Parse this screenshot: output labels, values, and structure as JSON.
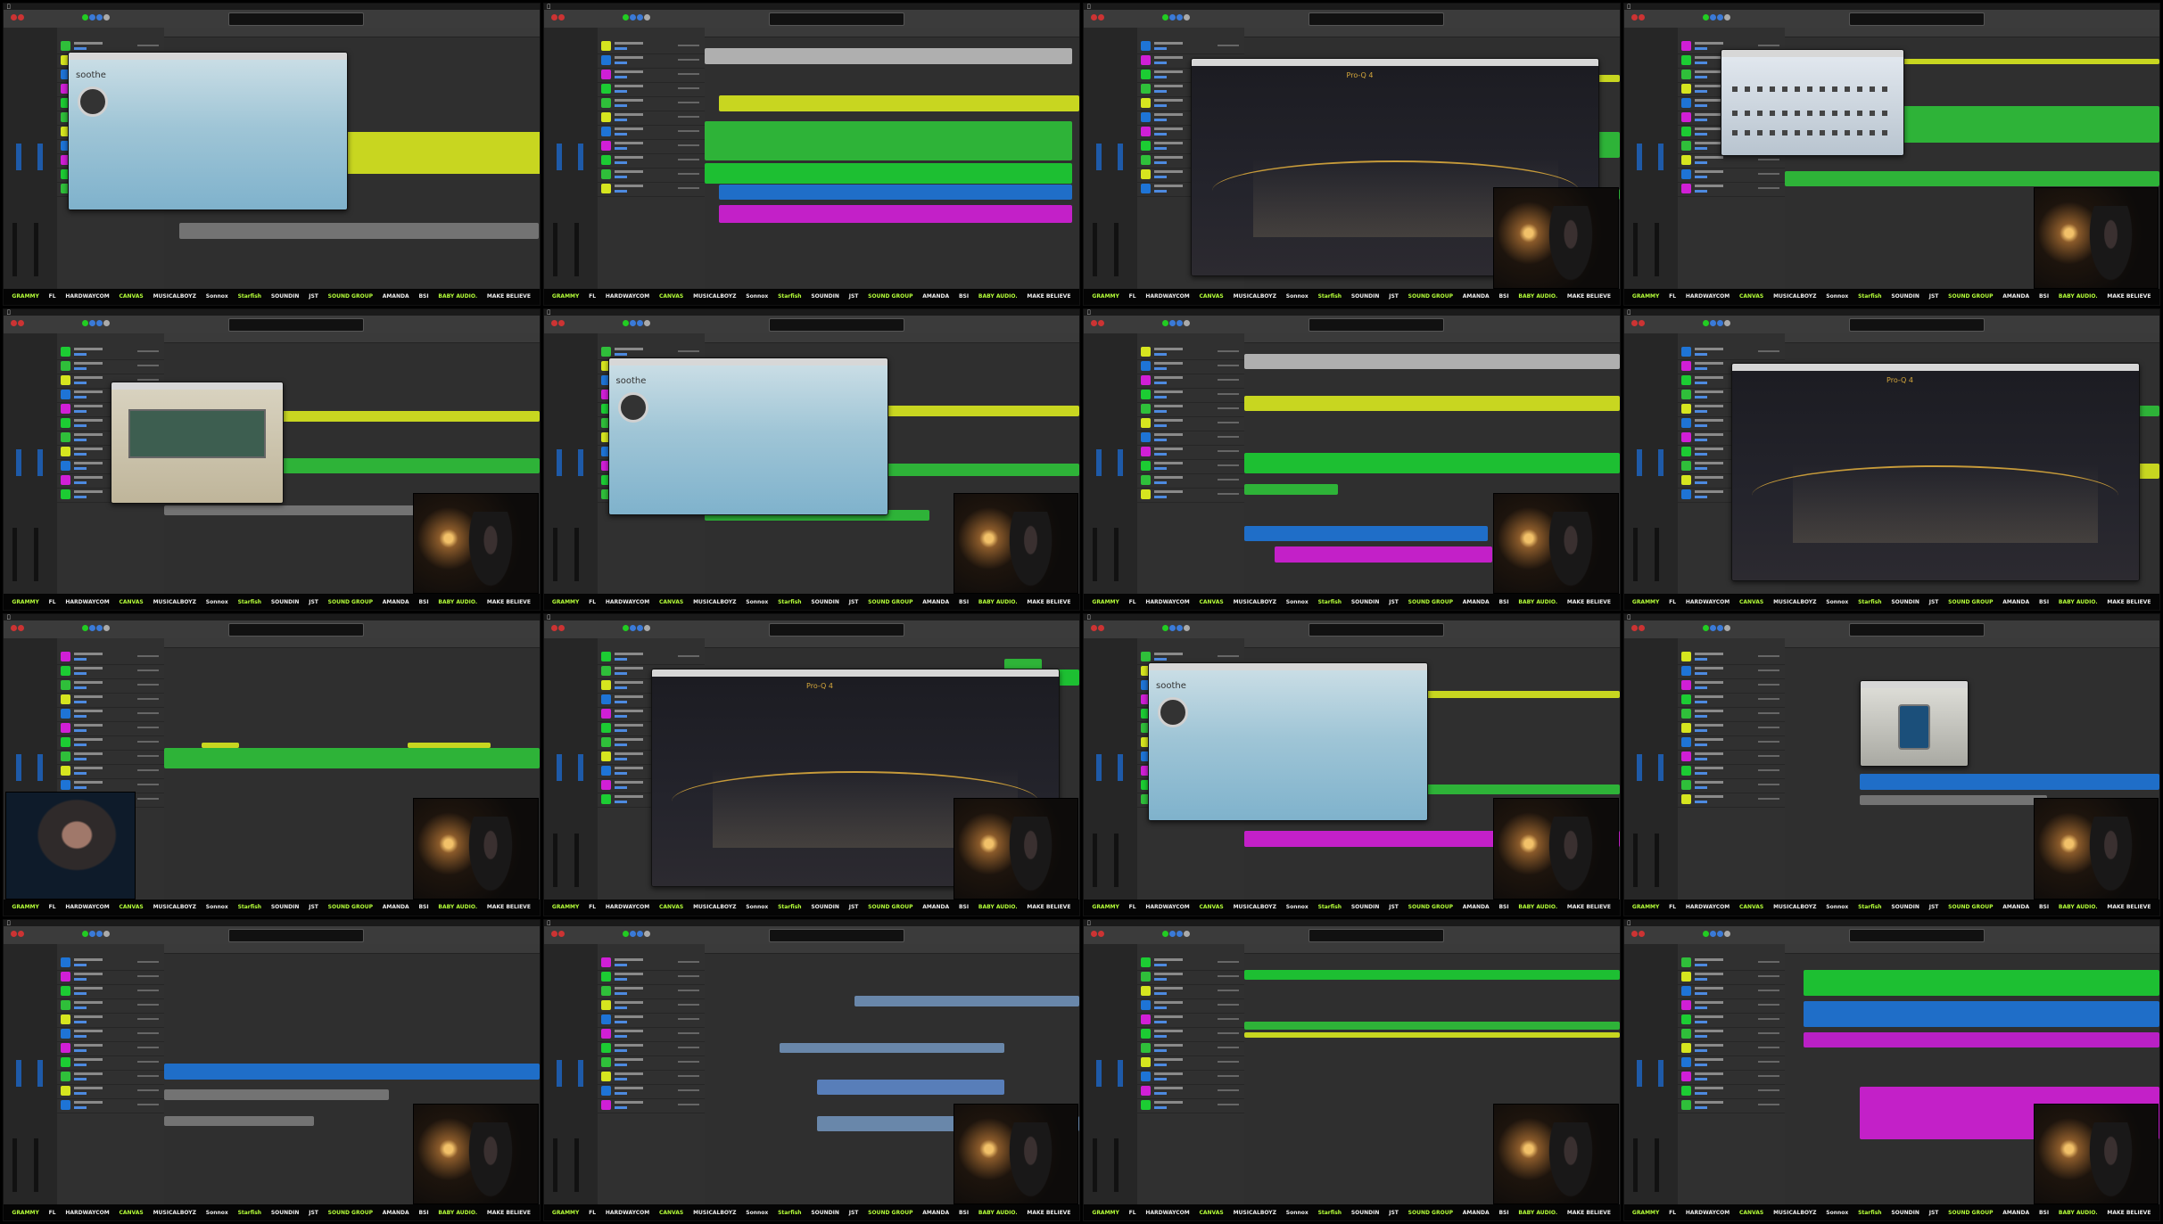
{
  "sponsors": [
    "GRAMMY",
    "FL",
    "HARDWAYCOM",
    "CANVAS",
    "MUSICALBOYZ",
    "Sonnox",
    "Starfish",
    "SOUNDIN",
    "JST",
    "SOUND GROUP",
    "AMANDA",
    "BSI",
    "BABY AUDIO.",
    "MAKE BELIEVE"
  ],
  "plugins": {
    "soothe": "soothe",
    "proq": "Pro-Q 4",
    "pultec": "PULTEC",
    "la2a": "TCA 2A",
    "eqp": "EQP"
  },
  "tiles": [
    {
      "plugin": "soothe",
      "cam": false,
      "regions": [
        [
          "#d6e51f",
          20,
          40,
          100,
          16
        ],
        [
          "#7a7a7a",
          4,
          75,
          96,
          6
        ]
      ]
    },
    {
      "plugin": null,
      "cam": false,
      "regions": [
        [
          "#bbbbbb",
          0,
          8,
          98,
          6
        ],
        [
          "#d6e51f",
          4,
          26,
          96,
          6
        ],
        [
          "#2fbf3a",
          0,
          36,
          98,
          15
        ],
        [
          "#1ccc33",
          0,
          52,
          98,
          8
        ],
        [
          "#1e74d6",
          4,
          60,
          94,
          6
        ],
        [
          "#d01fd6",
          4,
          68,
          94,
          7
        ]
      ]
    },
    {
      "plugin": "proq",
      "cam": true,
      "regions": [
        [
          "#2fbf3a",
          0,
          40,
          100,
          10
        ],
        [
          "#2fbf3a",
          0,
          62,
          100,
          4
        ],
        [
          "#d6e51f",
          0,
          18,
          100,
          3
        ]
      ]
    },
    {
      "plugin": "eqp",
      "cam": true,
      "regions": [
        [
          "#2fbf3a",
          0,
          30,
          100,
          14
        ],
        [
          "#2fbf3a",
          0,
          55,
          100,
          6
        ],
        [
          "#d6e51f",
          0,
          12,
          100,
          2
        ]
      ]
    },
    {
      "plugin": "pultec",
      "cam": true,
      "regions": [
        [
          "#2fbf3a",
          0,
          48,
          100,
          6
        ],
        [
          "#d6e51f",
          0,
          30,
          100,
          4
        ],
        [
          "#7a7a7a",
          0,
          66,
          70,
          4
        ]
      ]
    },
    {
      "plugin": "soothe",
      "cam": true,
      "regions": [
        [
          "#d6e51f",
          0,
          28,
          100,
          4
        ],
        [
          "#2fbf3a",
          0,
          50,
          100,
          5
        ],
        [
          "#2fbf3a",
          0,
          68,
          60,
          4
        ]
      ]
    },
    {
      "plugin": null,
      "cam": true,
      "regions": [
        [
          "#bbbbbb",
          0,
          8,
          100,
          6
        ],
        [
          "#d6e51f",
          0,
          24,
          100,
          6
        ],
        [
          "#1ccc33",
          0,
          46,
          100,
          8
        ],
        [
          "#2fbf3a",
          0,
          58,
          25,
          4
        ],
        [
          "#1e74d6",
          0,
          74,
          65,
          6
        ],
        [
          "#d01fd6",
          8,
          82,
          58,
          6
        ]
      ]
    },
    {
      "plugin": "proq",
      "cam": false,
      "regions": [
        [
          "#d6e51f",
          0,
          50,
          100,
          6
        ],
        [
          "#2fbf3a",
          0,
          28,
          100,
          4
        ]
      ]
    },
    {
      "plugin": null,
      "cam": true,
      "cam2": true,
      "regions": [
        [
          "#d6e51f",
          10,
          40,
          10,
          2
        ],
        [
          "#d6e51f",
          65,
          40,
          22,
          2
        ],
        [
          "#2fbf3a",
          0,
          42,
          100,
          8
        ]
      ]
    },
    {
      "plugin": "proq",
      "cam": true,
      "regions": [
        [
          "#1ccc33",
          0,
          12,
          100,
          6
        ],
        [
          "#2fbf3a",
          80,
          8,
          10,
          6
        ],
        [
          "#1e74d6",
          0,
          62,
          18,
          3
        ]
      ]
    },
    {
      "plugin": "soothe",
      "cam": true,
      "regions": [
        [
          "#d6e51f",
          0,
          20,
          100,
          3
        ],
        [
          "#2fbf3a",
          0,
          56,
          100,
          4
        ],
        [
          "#d01fd6",
          0,
          74,
          100,
          6
        ]
      ]
    },
    {
      "plugin": "la2a",
      "cam": true,
      "regions": [
        [
          "#1e74d6",
          20,
          52,
          80,
          6
        ],
        [
          "#7a7a7a",
          20,
          60,
          50,
          4
        ]
      ]
    },
    {
      "plugin": null,
      "cam": true,
      "regions": [
        [
          "#1e74d6",
          0,
          46,
          100,
          6
        ],
        [
          "#7a7a7a",
          0,
          56,
          60,
          4
        ],
        [
          "#7a7a7a",
          0,
          66,
          40,
          4
        ]
      ]
    },
    {
      "plugin": null,
      "cam": true,
      "regions": [
        [
          "#6f8fb5",
          40,
          20,
          60,
          4
        ],
        [
          "#6f8fb5",
          20,
          38,
          60,
          4
        ],
        [
          "#5c86c5",
          30,
          52,
          50,
          6
        ],
        [
          "#6f8fb5",
          30,
          66,
          70,
          6
        ]
      ]
    },
    {
      "plugin": null,
      "cam": true,
      "regions": [
        [
          "#1ccc33",
          0,
          10,
          100,
          4
        ],
        [
          "#2fbf3a",
          0,
          30,
          100,
          3
        ],
        [
          "#d6e51f",
          0,
          34,
          100,
          2
        ]
      ]
    },
    {
      "plugin": null,
      "cam": true,
      "regions": [
        [
          "#1ccc33",
          5,
          10,
          95,
          10
        ],
        [
          "#1e74d6",
          5,
          22,
          95,
          10
        ],
        [
          "#c51fd2",
          5,
          34,
          95,
          6
        ],
        [
          "#d01fd6",
          20,
          55,
          80,
          20
        ]
      ]
    }
  ],
  "track_icon_colors": [
    "#2fbf3a",
    "#d6e51f",
    "#1e74d6",
    "#d01fd6",
    "#1ccc33"
  ]
}
